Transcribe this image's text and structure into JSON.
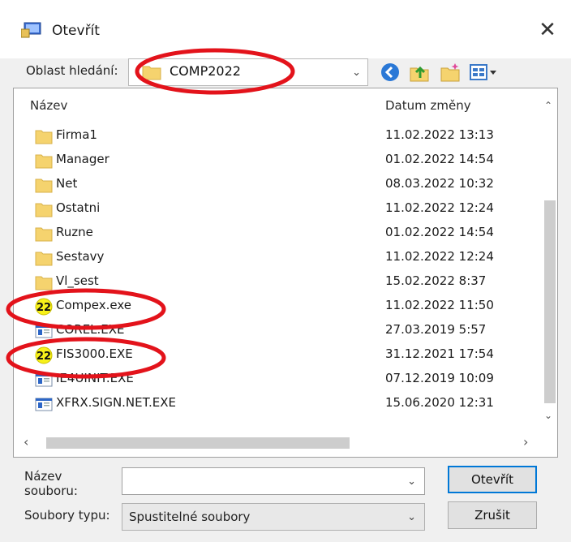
{
  "window": {
    "title": "Otevřít",
    "close_glyph": "✕"
  },
  "look_in": {
    "label": "Oblast hledání:",
    "value": "COMP2022"
  },
  "nav_icons": [
    "back-icon",
    "up-folder-icon",
    "new-folder-icon",
    "view-menu-icon"
  ],
  "list": {
    "columns": {
      "name": "Název",
      "date": "Datum změny"
    },
    "rows": [
      {
        "name": "Firma1",
        "date": "11.02.2022 13:13",
        "icon": "folder-icon"
      },
      {
        "name": "Manager",
        "date": "01.02.2022 14:54",
        "icon": "folder-icon"
      },
      {
        "name": "Net",
        "date": "08.03.2022 10:32",
        "icon": "folder-icon"
      },
      {
        "name": "Ostatni",
        "date": "11.02.2022 12:24",
        "icon": "folder-icon"
      },
      {
        "name": "Ruzne",
        "date": "01.02.2022 14:54",
        "icon": "folder-icon"
      },
      {
        "name": "Sestavy",
        "date": "11.02.2022 12:24",
        "icon": "folder-icon"
      },
      {
        "name": "Vl_sest",
        "date": "15.02.2022 8:37",
        "icon": "folder-icon"
      },
      {
        "name": "Compex.exe",
        "date": "11.02.2022 11:50",
        "icon": "app22-icon"
      },
      {
        "name": "COREL.EXE",
        "date": "27.03.2019 5:57",
        "icon": "exe-icon"
      },
      {
        "name": "FIS3000.EXE",
        "date": "31.12.2021 17:54",
        "icon": "app22-icon"
      },
      {
        "name": "IE4UINIT.EXE",
        "date": "07.12.2019 10:09",
        "icon": "exe-icon"
      },
      {
        "name": "XFRX.SIGN.NET.EXE",
        "date": "15.06.2020 12:31",
        "icon": "exe-icon"
      }
    ],
    "app_icon_text": "22"
  },
  "filename": {
    "label_line1": "Název",
    "label_line2": "souboru:",
    "value": ""
  },
  "filetype": {
    "label": "Soubory typu:",
    "value": "Spustitelné soubory"
  },
  "buttons": {
    "open": "Otevřít",
    "cancel": "Zrušit"
  },
  "colors": {
    "annotation": "#e3131b",
    "accent": "#0078d7",
    "folder": "#f5d36e"
  }
}
